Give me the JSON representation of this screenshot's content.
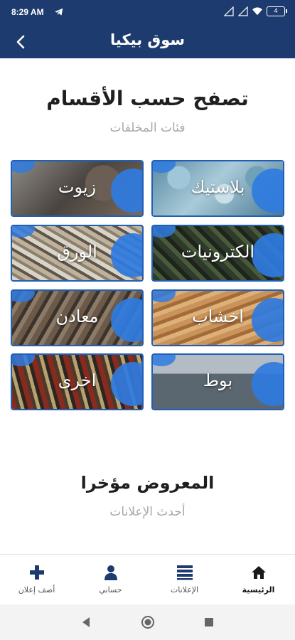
{
  "status_bar": {
    "time": "8:29 AM",
    "battery": "4"
  },
  "app_bar": {
    "title": "سوق بيكيا"
  },
  "categories_section": {
    "title": "تصفح حسب الأقسام",
    "subtitle": "فئات المخلفات"
  },
  "categories": [
    {
      "label": "بلاستيك",
      "icon": "plastic-image"
    },
    {
      "label": "زيوت",
      "icon": "oils-image"
    },
    {
      "label": "الكترونيات",
      "icon": "electronics-image"
    },
    {
      "label": "الورق",
      "icon": "paper-image"
    },
    {
      "label": "اخشاب",
      "icon": "wood-image"
    },
    {
      "label": "معادن",
      "icon": "metals-image"
    },
    {
      "label": "بوط",
      "icon": "oil-refinery-image"
    },
    {
      "label": "اخرى",
      "icon": "others-image"
    }
  ],
  "recent_section": {
    "title": "المعروض مؤخرا",
    "subtitle": "أحدث الإعلانات"
  },
  "bottom_nav": [
    {
      "label": "الرئيسية",
      "icon": "home-icon",
      "active": true
    },
    {
      "label": "الإعلانات",
      "icon": "list-icon",
      "active": false
    },
    {
      "label": "حسابي",
      "icon": "user-icon",
      "active": false
    },
    {
      "label": "أضف إعلان",
      "icon": "plus-icon",
      "active": false
    }
  ],
  "colors": {
    "primary": "#1d3b6e",
    "accent": "#2f7be0",
    "tile_border": "#1f5fb8"
  }
}
